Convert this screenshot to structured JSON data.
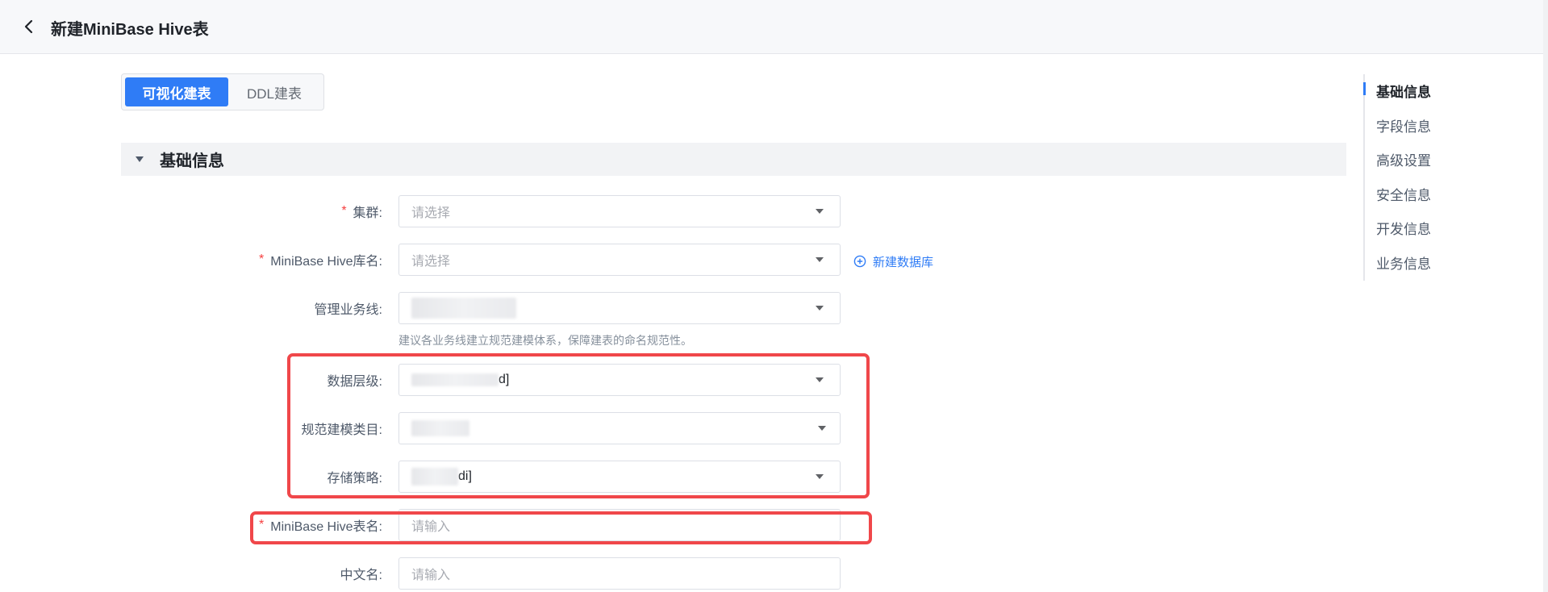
{
  "header": {
    "title": "新建MiniBase Hive表"
  },
  "tabs": [
    {
      "label": "可视化建表",
      "active": true
    },
    {
      "label": "DDL建表",
      "active": false
    }
  ],
  "section": {
    "title": "基础信息"
  },
  "form": {
    "cluster": {
      "label": "集群:",
      "placeholder": "请选择",
      "required": true
    },
    "database": {
      "label": "MiniBase Hive库名:",
      "placeholder": "请选择",
      "required": true
    },
    "add_database": {
      "label": "新建数据库"
    },
    "business_line": {
      "label": "管理业务线:",
      "hint": "建议各业务线建立规范建模体系，保障建表的命名规范性。"
    },
    "data_layer": {
      "label": "数据层级:",
      "value_suffix": "d]"
    },
    "model_category": {
      "label": "规范建模类目:"
    },
    "storage_policy": {
      "label": "存储策略:",
      "value_suffix": "di]"
    },
    "table_name": {
      "label": "MiniBase Hive表名:",
      "placeholder": "请输入",
      "required": true
    },
    "chinese_name": {
      "label": "中文名:",
      "placeholder": "请输入"
    }
  },
  "anchor_nav": [
    {
      "label": "基础信息",
      "active": true
    },
    {
      "label": "字段信息"
    },
    {
      "label": "高级设置"
    },
    {
      "label": "安全信息"
    },
    {
      "label": "开发信息"
    },
    {
      "label": "业务信息"
    }
  ],
  "colors": {
    "primary": "#2f7cf6",
    "required": "#f53f3f",
    "highlight": "#f0474a"
  }
}
